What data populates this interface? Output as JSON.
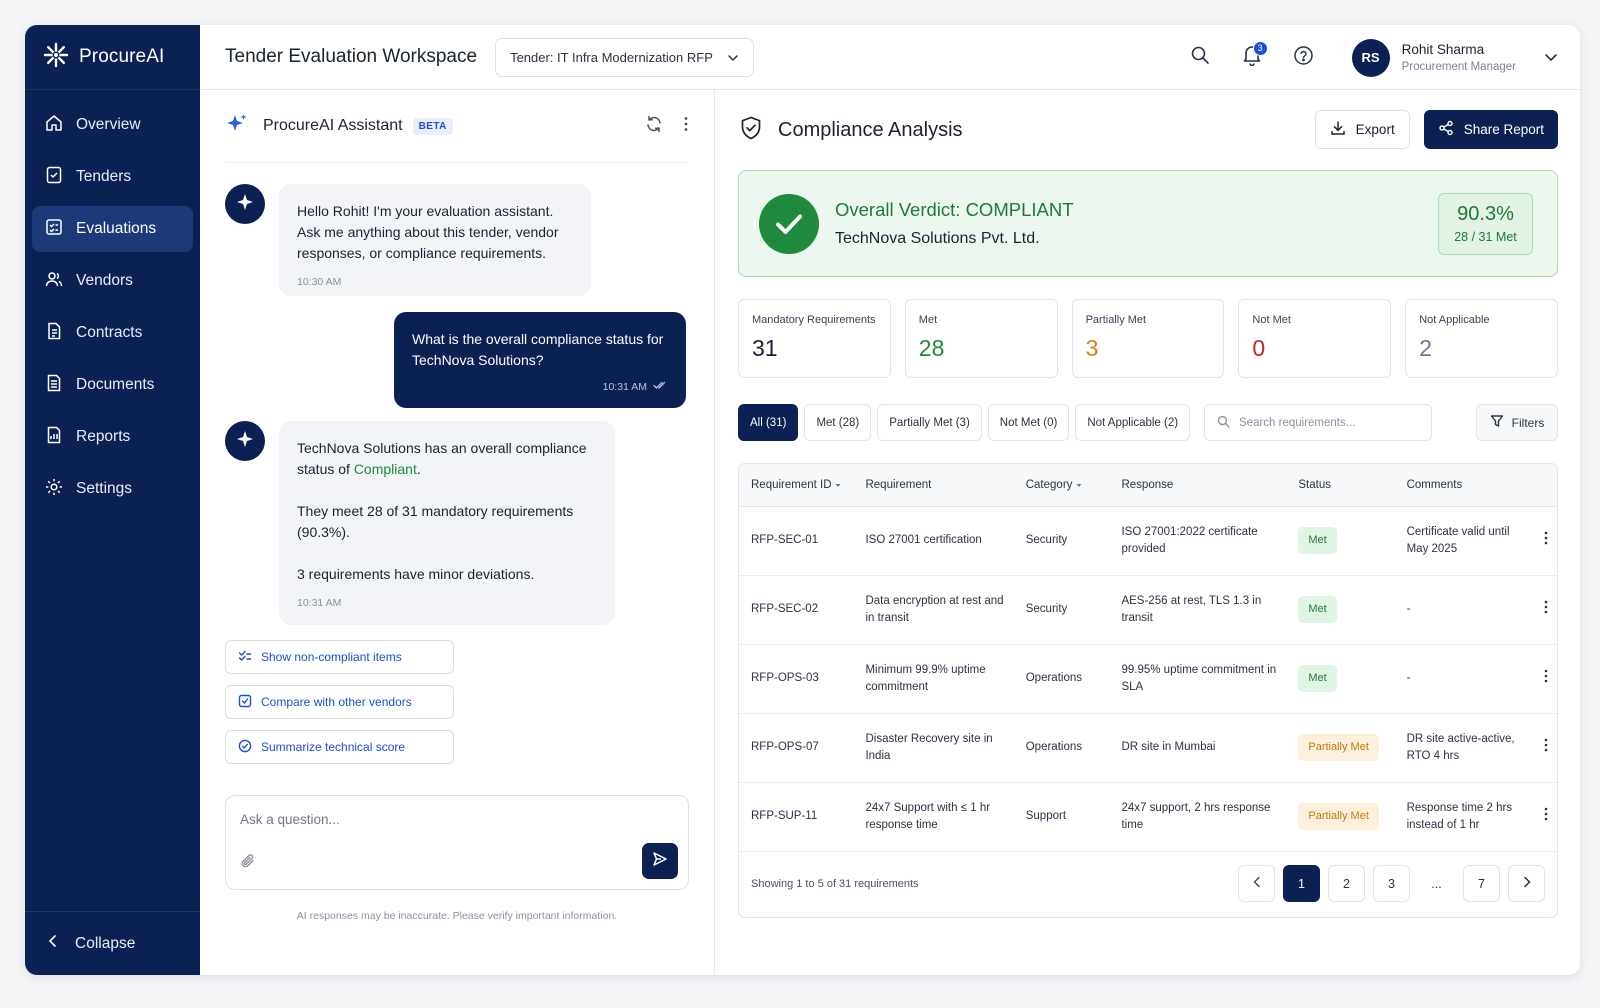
{
  "brand": {
    "name": "ProcureAI"
  },
  "sidebar": {
    "items": [
      {
        "label": "Overview",
        "icon": "home-icon",
        "active": false
      },
      {
        "label": "Tenders",
        "icon": "tender-icon",
        "active": false
      },
      {
        "label": "Evaluations",
        "icon": "evaluation-icon",
        "active": true
      },
      {
        "label": "Vendors",
        "icon": "vendors-icon",
        "active": false
      },
      {
        "label": "Contracts",
        "icon": "contract-icon",
        "active": false
      },
      {
        "label": "Documents",
        "icon": "document-icon",
        "active": false
      },
      {
        "label": "Reports",
        "icon": "report-icon",
        "active": false
      },
      {
        "label": "Settings",
        "icon": "gear-icon",
        "active": false
      }
    ],
    "collapse_label": "Collapse"
  },
  "header": {
    "title": "Tender Evaluation Workspace",
    "tender_select": "Tender: IT Infra Modernization RFP",
    "notification_count": "3",
    "user": {
      "initials": "RS",
      "name": "Rohit Sharma",
      "role": "Procurement Manager"
    }
  },
  "chat": {
    "title": "ProcureAI Assistant",
    "badge": "BETA",
    "messages": [
      {
        "from": "bot",
        "text": "Hello Rohit! I'm your evaluation assistant. Ask me anything about this tender, vendor responses, or compliance requirements.",
        "time": "10:30 AM"
      },
      {
        "from": "user",
        "text": "What is the overall compliance status for TechNova Solutions?",
        "time": "10:31 AM"
      },
      {
        "from": "bot",
        "text_pre": "TechNova Solutions has an overall compliance status of ",
        "text_highlight": "Compliant",
        "text_post": ".",
        "para2": "They meet 28 of 31 mandatory requirements (90.3%).",
        "para3": "3 requirements have minor deviations.",
        "time": "10:31 AM"
      }
    ],
    "suggestions": [
      {
        "label": "Show non-compliant items",
        "icon": "checklist-icon"
      },
      {
        "label": "Compare with other vendors",
        "icon": "compare-icon"
      },
      {
        "label": "Summarize technical score",
        "icon": "check-circle-icon"
      }
    ],
    "input_placeholder": "Ask a question...",
    "disclaimer": "AI responses may be inaccurate. Please verify important information."
  },
  "analysis": {
    "title": "Compliance Analysis",
    "export_label": "Export",
    "share_label": "Share Report",
    "verdict": {
      "title": "Overall Verdict: COMPLIANT",
      "vendor": "TechNova Solutions Pvt. Ltd.",
      "score": "90.3%",
      "score_sub": "28 / 31 Met"
    },
    "stats": [
      {
        "label": "Mandatory Requirements",
        "value": "31",
        "color": "#1b2233"
      },
      {
        "label": "Met",
        "value": "28",
        "color": "#1f8a3b"
      },
      {
        "label": "Partially Met",
        "value": "3",
        "color": "#e07f12"
      },
      {
        "label": "Not Met",
        "value": "0",
        "color": "#c62828"
      },
      {
        "label": "Not Applicable",
        "value": "2",
        "color": "#6f778a"
      }
    ],
    "filters": [
      {
        "label": "All (31)",
        "active": true
      },
      {
        "label": "Met (28)",
        "active": false
      },
      {
        "label": "Partially Met (3)",
        "active": false
      },
      {
        "label": "Not Met (0)",
        "active": false
      },
      {
        "label": "Not Applicable (2)",
        "active": false
      }
    ],
    "search_placeholder": "Search requirements...",
    "filters_label": "Filters",
    "table": {
      "headers": [
        "Requirement ID",
        "Requirement",
        "Category",
        "Response",
        "Status",
        "Comments"
      ],
      "rows": [
        {
          "id": "RFP-SEC-01",
          "requirement": "ISO 27001 certification",
          "category": "Security",
          "response": "ISO 27001:2022 certificate provided",
          "status": "Met",
          "comments": "Certificate valid until May 2025"
        },
        {
          "id": "RFP-SEC-02",
          "requirement": "Data encryption at rest and in transit",
          "category": "Security",
          "response": "AES-256 at rest, TLS 1.3 in transit",
          "status": "Met",
          "comments": "-"
        },
        {
          "id": "RFP-OPS-03",
          "requirement": "Minimum 99.9% uptime commitment",
          "category": "Operations",
          "response": "99.95% uptime commitment in SLA",
          "status": "Met",
          "comments": "-"
        },
        {
          "id": "RFP-OPS-07",
          "requirement": "Disaster Recovery site in India",
          "category": "Operations",
          "response": "DR site in Mumbai",
          "status": "Partially Met",
          "comments": "DR site active-active, RTO 4 hrs"
        },
        {
          "id": "RFP-SUP-11",
          "requirement": "24x7 Support with ≤ 1 hr response time",
          "category": "Support",
          "response": "24x7 support, 2 hrs response time",
          "status": "Partially Met",
          "comments": "Response time 2 hrs instead of 1 hr"
        }
      ]
    },
    "pagination": {
      "summary": "Showing 1 to 5 of 31 requirements",
      "pages": [
        "1",
        "2",
        "3",
        "...",
        "7"
      ],
      "current": "1"
    }
  }
}
